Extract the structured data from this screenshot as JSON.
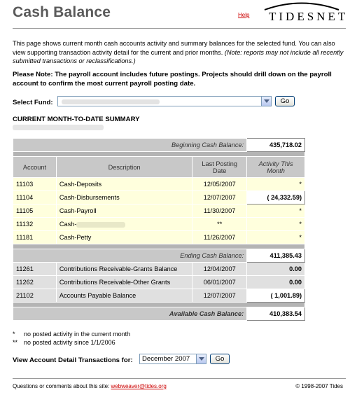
{
  "header": {
    "title": "Cash Balance",
    "help": "Help",
    "logo": "TIDESNET"
  },
  "intro": {
    "text": "This page shows current month cash accounts activity and summary balances for the selected fund. You can also view supporting transaction activity detail for the current and prior months.",
    "note": "(Note: reports may not include all recently submitted transactions or reclassifications.)"
  },
  "notice": "Please Note: The payroll account includes future postings. Projects should drill down on the payroll account to confirm the most current payroll posting date.",
  "fund": {
    "label": "Select Fund:",
    "go": "Go"
  },
  "summary": {
    "heading": "CURRENT MONTH-TO-DATE SUMMARY"
  },
  "table": {
    "beginning_label": "Beginning Cash Balance:",
    "beginning_value": "435,718.02",
    "headers": {
      "account": "Account",
      "description": "Description",
      "last_posting": "Last Posting Date",
      "activity": "Activity This Month"
    },
    "rows": [
      {
        "account": "11103",
        "description": "Cash-Deposits",
        "date": "12/05/2007",
        "activity": "*"
      },
      {
        "account": "11104",
        "description": "Cash-Disbursements",
        "date": "12/07/2007",
        "activity": "( 24,332.59)"
      },
      {
        "account": "11105",
        "description": "Cash-Payroll",
        "date": "11/30/2007",
        "activity": "*"
      },
      {
        "account": "11132",
        "description": "Cash-",
        "date": "**",
        "activity": "*"
      },
      {
        "account": "11181",
        "description": "Cash-Petty",
        "date": "11/26/2007",
        "activity": "*"
      }
    ],
    "ending_label": "Ending Cash Balance:",
    "ending_value": "411,385.43",
    "other_rows": [
      {
        "account": "11261",
        "description": "Contributions Receivable-Grants Balance",
        "date": "12/04/2007",
        "activity": "0.00"
      },
      {
        "account": "11262",
        "description": "Contributions Receivable-Other Grants",
        "date": "06/01/2007",
        "activity": "0.00"
      },
      {
        "account": "21102",
        "description": "Accounts Payable Balance",
        "date": "12/07/2007",
        "activity": "( 1,001.89)"
      }
    ],
    "available_label": "Available Cash Balance:",
    "available_value": "410,383.54"
  },
  "legend": {
    "star1": "*",
    "star1_text": "no posted activity in the current month",
    "star2": "**",
    "star2_text": "no posted activity since 1/1/2006"
  },
  "detail": {
    "label": "View Account Detail Transactions for:",
    "month": "December 2007",
    "go": "Go"
  },
  "footer": {
    "left": "Questions or comments about this site:",
    "email": "webweaver@tides.org",
    "right": "© 1998-2007 Tides"
  }
}
